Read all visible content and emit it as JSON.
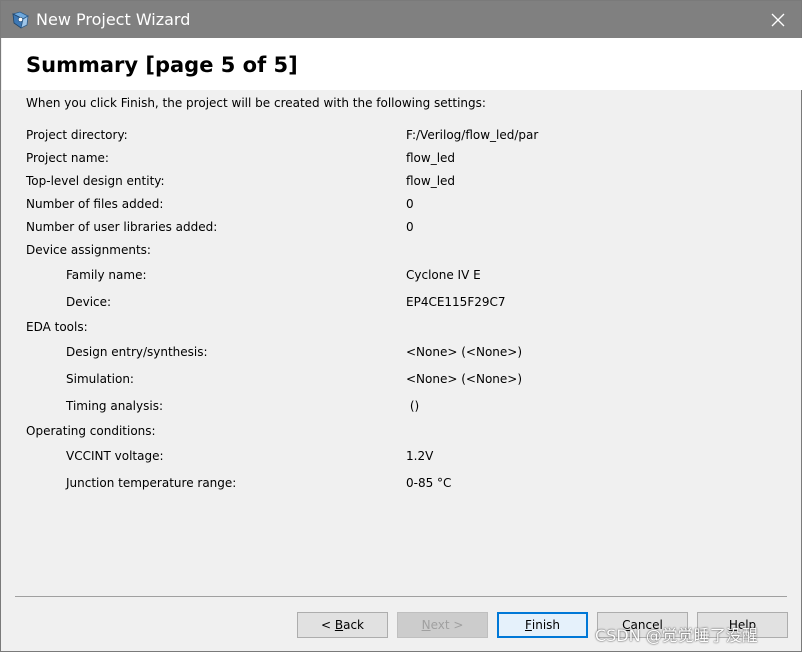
{
  "window": {
    "title": "New Project Wizard",
    "app_icon": "quartus-app-icon",
    "close_icon": "close-icon"
  },
  "header": {
    "title": "Summary [page 5 of 5]"
  },
  "intro": "When you click Finish, the project will be created with the following settings:",
  "settings": [
    {
      "label": "Project directory:",
      "value": "F:/Verilog/flow_led/par"
    },
    {
      "label": "Project name:",
      "value": "flow_led"
    },
    {
      "label": "Top-level design entity:",
      "value": "flow_led"
    },
    {
      "label": "Number of files added:",
      "value": "0"
    },
    {
      "label": "Number of user libraries added:",
      "value": "0"
    },
    {
      "label": "Device assignments:",
      "value": ""
    },
    {
      "label": "Family name:",
      "value": "Cyclone IV E"
    },
    {
      "label": "Device:",
      "value": "EP4CE115F29C7"
    },
    {
      "label": "EDA tools:",
      "value": ""
    },
    {
      "label": "Design entry/synthesis:",
      "value": "<None> (<None>)"
    },
    {
      "label": "Simulation:",
      "value": "<None> (<None>)"
    },
    {
      "label": "Timing analysis:",
      "value": " ()"
    },
    {
      "label": "Operating conditions:",
      "value": ""
    },
    {
      "label": "VCCINT voltage:",
      "value": "1.2V"
    },
    {
      "label": "Junction temperature range:",
      "value": "0-85 °C"
    }
  ],
  "buttons": {
    "back": {
      "mnemonic": "B",
      "rest": "ack",
      "prefix": "< "
    },
    "next": {
      "mnemonic": "N",
      "rest": "ext >",
      "prefix": ""
    },
    "finish": {
      "mnemonic": "F",
      "rest": "inish",
      "prefix": ""
    },
    "cancel": {
      "mnemonic": "C",
      "rest": "ancel",
      "prefix": ""
    },
    "help": {
      "mnemonic": "H",
      "rest": "elp",
      "prefix": ""
    }
  },
  "watermark": "CSDN @觉觉睡了没醒"
}
